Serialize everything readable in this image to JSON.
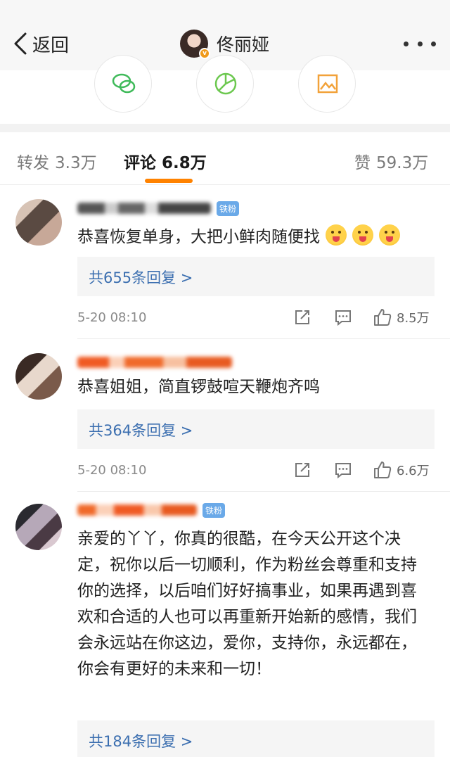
{
  "nav": {
    "back_label": "返回",
    "title": "佟丽娅",
    "verified_badge": "v"
  },
  "share_icons": [
    "wechat-icon",
    "moments-icon",
    "save-image-icon"
  ],
  "tabs": {
    "repost": {
      "label": "转发",
      "count": "3.3万"
    },
    "comments": {
      "label": "评论",
      "count": "6.8万"
    },
    "likes": {
      "label": "赞",
      "count": "59.3万"
    },
    "accent_color": "#ff8200"
  },
  "comments": [
    {
      "text": "恭喜恢复单身，大把小鲜肉随便找",
      "emoji_count": 3,
      "badge": "铁粉",
      "replies": "共655条回复 >",
      "time": "5-20 08:10",
      "likes": "8.5万"
    },
    {
      "text": "恭喜姐姐，简直锣鼓喧天鞭炮齐鸣",
      "badge": "",
      "replies": "共364条回复 >",
      "time": "5-20 08:10",
      "likes": "6.6万"
    },
    {
      "text": "亲爱的丫丫，你真的很酷，在今天公开这个决定，祝你以后一切顺利，作为粉丝会尊重和支持你的选择，以后咱们好好搞事业，如果再遇到喜欢和合适的人也可以再重新开始新的感情，我们会永远站在你这边，爱你，支持你，永远都在，你会有更好的未来和一切！",
      "badge": "铁粉",
      "replies": "共184条回复 >"
    }
  ],
  "colors": {
    "link": "#3c6fb0",
    "fan_badge": "#6aa9e8",
    "verified": "#f09a1a"
  }
}
